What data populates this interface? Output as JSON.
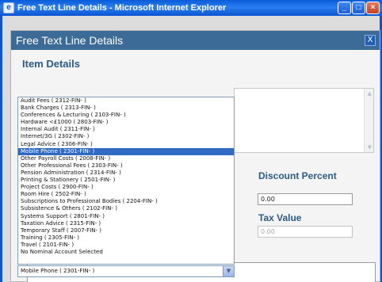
{
  "window": {
    "title": "Free Text Line Details - Microsoft Internet Explorer",
    "app_icon": "ie-icon",
    "buttons": {
      "minimize": "_",
      "maximize": "□",
      "close": "×"
    }
  },
  "dialog": {
    "header_title": "Free Text Line Details",
    "close_label": "X",
    "section_title": "Item Details"
  },
  "fields": {
    "discount_percent_label": "Discount Percent",
    "discount_percent_value": "0.00",
    "tax_value_label": "Tax Value",
    "tax_value_value": "0.00"
  },
  "nominal_dropdown": {
    "selected": "Mobile Phone ( 2301-FIN- )",
    "options": [
      "Audit Fees ( 2312-FIN- )",
      "Bank Charges ( 2313-FIN- )",
      "Conferences & Lecturing ( 2103-FIN- )",
      "Hardware <£1000 ( 2803-FIN- )",
      "Internal Audit ( 2311-FIN- )",
      "Internet/3G ( 2302-FIN- )",
      "Legal Advice ( 2306-FIN- )",
      "Mobile Phone ( 2301-FIN- )",
      "Other Payroll Costs ( 2008-FIN- )",
      "Other Professional Fees ( 2303-FIN- )",
      "Pension Administration ( 2314-FIN- )",
      "Printing & Stationery ( 2501-FIN- )",
      "Project Costs ( 2900-FIN- )",
      "Room Hire ( 2502-FIN- )",
      "Subscriptions to Professional Bodies ( 2204-FIN- )",
      "Subsistence & Others ( 2102-FIN- )",
      "Systems Support ( 2801-FIN- )",
      "Taxation Advice ( 2315-FIN- )",
      "Temporary Staff ( 2007-FIN- )",
      "Training ( 2305-FIN- )",
      "Travel ( 2101-FIN- )",
      "No Nominal Account Selected"
    ],
    "selected_index": 7
  }
}
